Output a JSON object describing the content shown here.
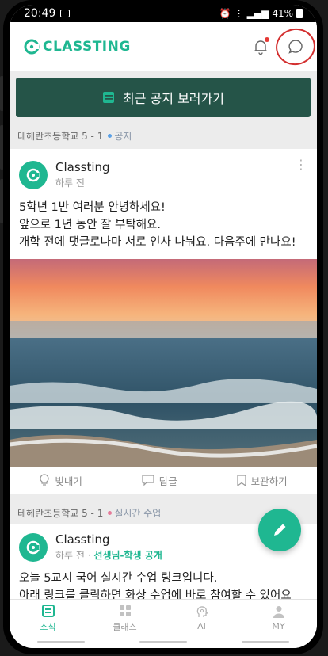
{
  "status_bar": {
    "time": "20:49",
    "battery": "41%"
  },
  "app": {
    "logo_text": "CLASSTING"
  },
  "notice_button": {
    "label": "최근 공지 보러가기"
  },
  "posts": [
    {
      "class_name": "테헤란초등학교 5 - 1",
      "tag": "공지",
      "tag_color": "#5aa0e6",
      "author": "Classting",
      "time": "하루 전",
      "lines": [
        "5학년 1반 여러분 안녕하세요!",
        "앞으로 1년 동안 잘 부탁해요.",
        "개학 전에 댓글로나마 서로 인사 나눠요. 다음주에 만나요!"
      ],
      "actions": {
        "like": "빛내기",
        "reply": "답글",
        "save": "보관하기"
      }
    },
    {
      "class_name": "테헤란초등학교 5 - 1",
      "tag": "실시간 수업",
      "tag_color": "#e57b9a",
      "author": "Classting",
      "time": "하루 전",
      "audience": "선생님-학생 공개",
      "lines": [
        "오늘 5교시 국어 실시간 수업 링크입니다.",
        "아래 링크를 클릭하면 화상 수업에 바로 참여할 수 있어요"
      ]
    }
  ],
  "tabs": [
    {
      "label": "소식",
      "icon": "news-icon",
      "active": true
    },
    {
      "label": "클래스",
      "icon": "grid-icon",
      "active": false
    },
    {
      "label": "AI",
      "icon": "ai-icon",
      "active": false
    },
    {
      "label": "MY",
      "icon": "person-icon",
      "active": false
    }
  ],
  "colors": {
    "brand": "#1fb791",
    "banner": "#255448",
    "annotation": "#d32f2f"
  }
}
